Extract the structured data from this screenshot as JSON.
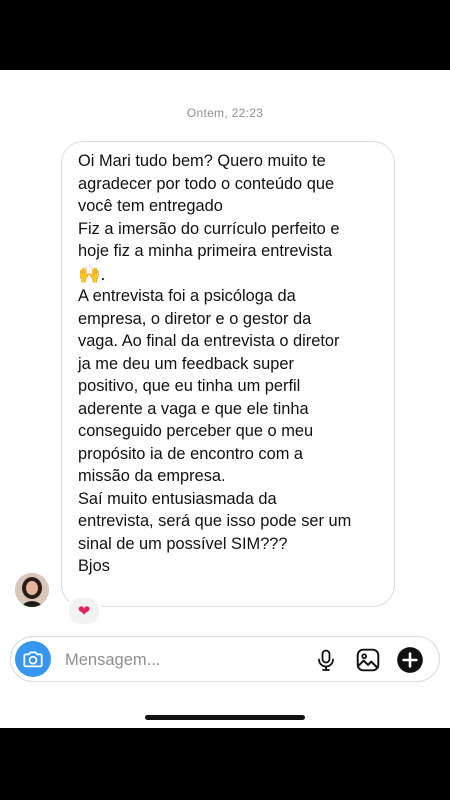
{
  "thread": {
    "timestamp": "Ontem, 22:23"
  },
  "message": {
    "lines": [
      "Oi Mari tudo bem? Quero muito te",
      "agradecer por todo o conteúdo que",
      "você tem entregado",
      "Fiz a imersão do currículo perfeito e",
      "hoje fiz a minha primeira entrevista",
      "🙌.",
      "A entrevista foi a psicóloga da",
      "empresa, o diretor e o gestor da",
      "vaga. Ao final da entrevista o diretor",
      "ja me deu um feedback super",
      "positivo, que eu tinha um perfil",
      "aderente a vaga e que ele tinha",
      "conseguido perceber que o meu",
      "propósito ia de encontro com a",
      "missão da empresa.",
      "Saí muito entusiasmada da",
      "entrevista, será que isso pode ser um",
      "sinal de um possível SIM???",
      "Bjos"
    ],
    "reaction": "❤"
  },
  "composer": {
    "placeholder": "Mensagem...",
    "icons": [
      "camera-icon",
      "microphone-icon",
      "gallery-icon",
      "plus-icon"
    ],
    "accent_color": "#3797f0"
  }
}
